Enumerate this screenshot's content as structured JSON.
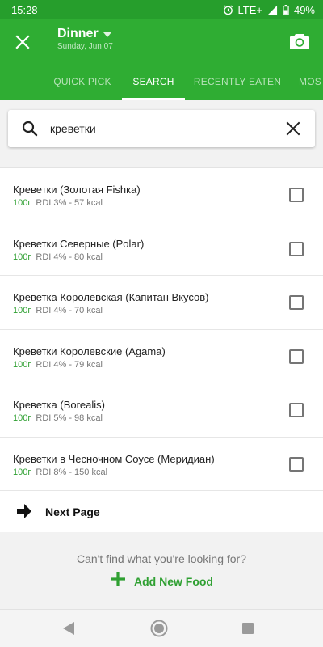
{
  "status_bar": {
    "time": "15:28",
    "network": "LTE+",
    "battery": "49%"
  },
  "app_bar": {
    "meal_title": "Dinner",
    "meal_date": "Sunday, Jun 07",
    "tabs": [
      {
        "label": "QUICK PICK",
        "active": false
      },
      {
        "label": "SEARCH",
        "active": true
      },
      {
        "label": "RECENTLY EATEN",
        "active": false
      },
      {
        "label": "MOS",
        "active": false
      }
    ]
  },
  "search": {
    "value": "креветки"
  },
  "results": [
    {
      "name": "Креветки (Золотая Fishка)",
      "serving": "100г",
      "info": "RDI 3% - 57 kcal",
      "checked": false
    },
    {
      "name": "Креветки Северные (Polar)",
      "serving": "100г",
      "info": "RDI 4% - 80 kcal",
      "checked": false
    },
    {
      "name": "Креветка Королевская (Капитан Вкусов)",
      "serving": "100г",
      "info": "RDI 4% - 70 kcal",
      "checked": false
    },
    {
      "name": "Креветки Королевские (Agama)",
      "serving": "100г",
      "info": "RDI 4% - 79 kcal",
      "checked": false
    },
    {
      "name": "Креветка (Borealis)",
      "serving": "100г",
      "info": "RDI 5% - 98 kcal",
      "checked": false
    },
    {
      "name": "Креветки в Чесночном Соусе (Меридиан)",
      "serving": "100г",
      "info": "RDI 8% - 150 kcal",
      "checked": false
    }
  ],
  "next_page_label": "Next Page",
  "footer": {
    "cant_find": "Can't find what you're looking for?",
    "add_new_food": "Add New Food"
  },
  "colors": {
    "primary": "#2fad33",
    "status_bar": "#269e2c",
    "accent_text": "#2fa032"
  }
}
